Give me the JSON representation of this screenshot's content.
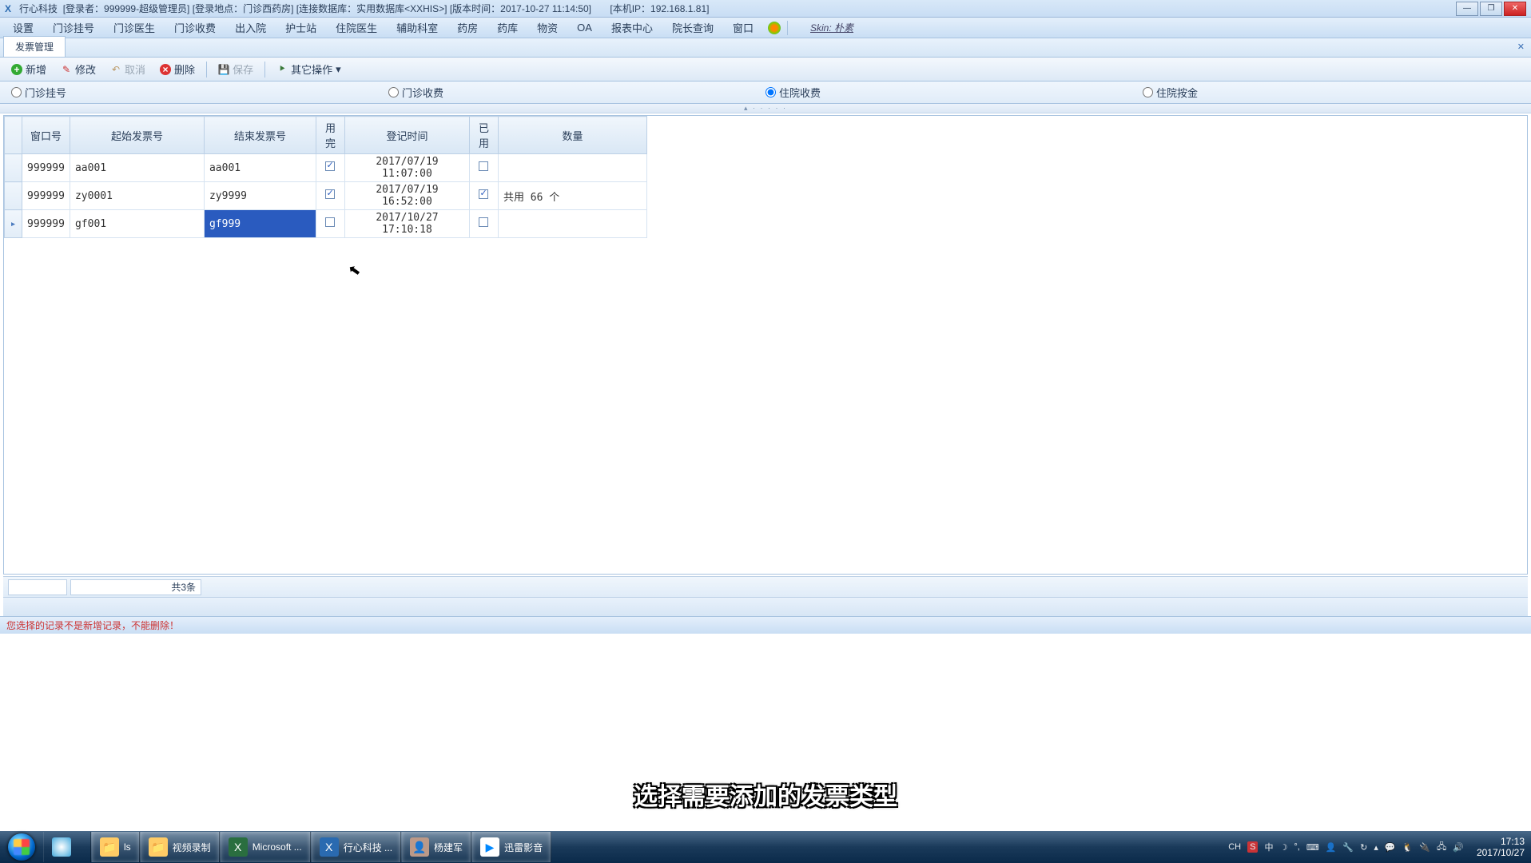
{
  "title": {
    "app": "行心科技",
    "login": "[登录者：999999-超级管理员]",
    "location": "[登录地点：门诊西药房]",
    "db": "[连接数据库：实用数据库<XXHIS>]",
    "version": "[版本时间：2017-10-27 11:14:50]",
    "ip": "[本机IP：192.168.1.81]"
  },
  "menu": [
    "设置",
    "门诊挂号",
    "门诊医生",
    "门诊收费",
    "出入院",
    "护士站",
    "住院医生",
    "辅助科室",
    "药房",
    "药库",
    "物资",
    "OA",
    "报表中心",
    "院长查询",
    "窗口"
  ],
  "skin": "Skin: 朴素",
  "tab": "发票管理",
  "toolbar": {
    "add": "新增",
    "edit": "修改",
    "cancel": "取消",
    "del": "删除",
    "save": "保存",
    "more": "其它操作"
  },
  "radios": {
    "r1": "门诊挂号",
    "r2": "门诊收费",
    "r3": "住院收费",
    "r4": "住院按金"
  },
  "columns": [
    "窗口号",
    "起始发票号",
    "结束发票号",
    "用完",
    "登记时间",
    "已用",
    "数量"
  ],
  "rows": [
    {
      "win": "999999",
      "start": "aa001",
      "end": "aa001",
      "done": true,
      "time": "2017/07/19 11:07:00",
      "used": false,
      "qty": ""
    },
    {
      "win": "999999",
      "start": "zy0001",
      "end": "zy9999",
      "done": true,
      "time": "2017/07/19 16:52:00",
      "used": true,
      "qty": "共用 66 个"
    },
    {
      "win": "999999",
      "start": "gf001",
      "end": "gf999",
      "done": false,
      "time": "2017/10/27 17:10:18",
      "used": false,
      "qty": ""
    }
  ],
  "total": "共3条",
  "status": "您选择的记录不是新增记录，不能删除！",
  "subtitle": "选择需要添加的发票类型",
  "taskbar": {
    "items": [
      {
        "label": "ls"
      },
      {
        "label": "视频录制"
      },
      {
        "label": "Microsoft ..."
      },
      {
        "label": "行心科技  ..."
      },
      {
        "label": "杨建军"
      },
      {
        "label": "迅雷影音"
      }
    ],
    "ime": "CH",
    "clock_time": "17:13",
    "clock_date": "2017/10/27"
  }
}
